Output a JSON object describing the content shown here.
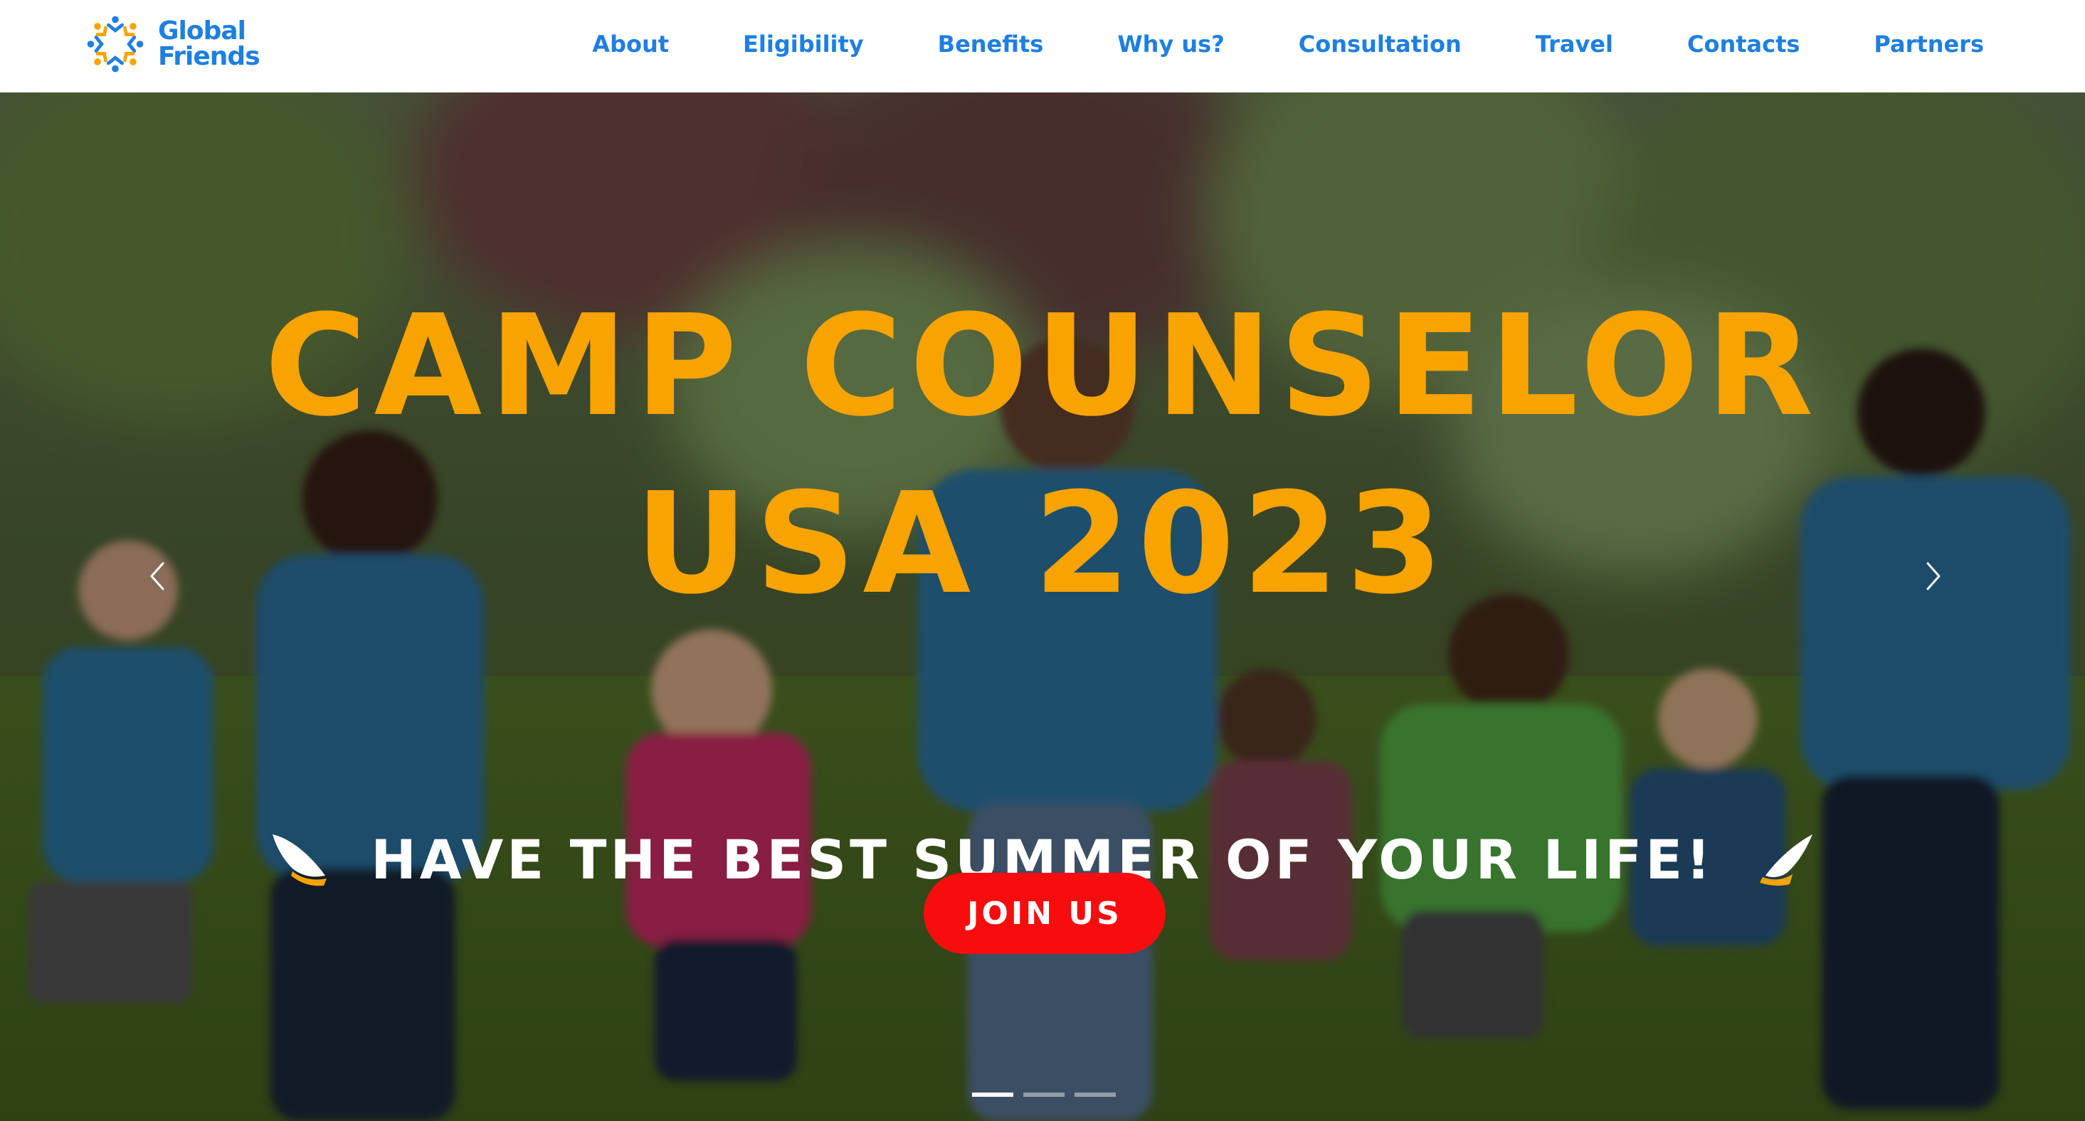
{
  "brand": {
    "name_line1": "Global",
    "name_line2": "Friends",
    "logo_icon": "people-ring-logo",
    "colors": {
      "blue": "#1e7fe0",
      "orange": "#f9a300"
    }
  },
  "nav": {
    "items": [
      {
        "label": "About"
      },
      {
        "label": "Eligibility"
      },
      {
        "label": "Benefits"
      },
      {
        "label": "Why us?"
      },
      {
        "label": "Consultation"
      },
      {
        "label": "Travel"
      },
      {
        "label": "Contacts"
      },
      {
        "label": "Partners"
      }
    ]
  },
  "hero": {
    "title_line1": "CAMP COUNSELOR",
    "title_line2": "USA 2023",
    "subtitle": "HAVE THE BEST SUMMER OF YOUR LIFE!",
    "cta_label": "JOIN US",
    "title_color": "#f9a300",
    "cta_color": "#f70d0d",
    "prev_icon": "chevron-left-icon",
    "next_icon": "chevron-right-icon",
    "slide_count": 3,
    "active_slide": 1
  }
}
